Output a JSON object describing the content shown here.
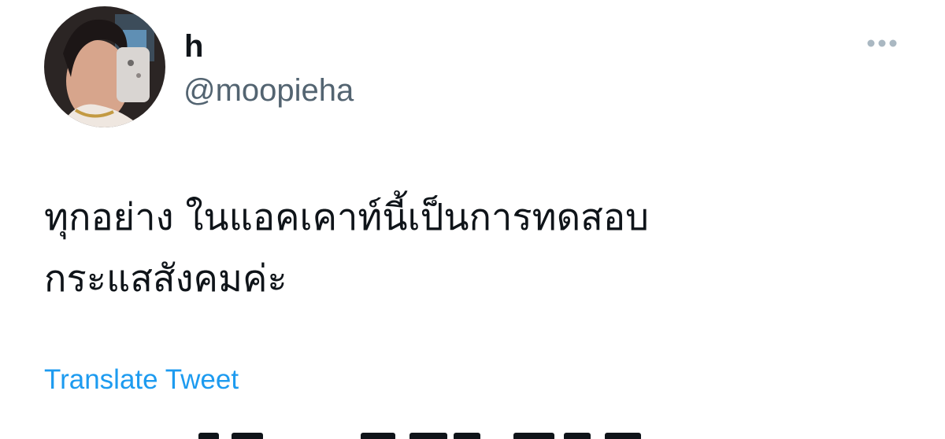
{
  "user": {
    "display_name": "h",
    "handle": "@moopieha"
  },
  "tweet": {
    "text_lines": [
      "ทุกอย่าง ในแอคเคาท์นี้เป็นการทดสอบ",
      "กระแสสังคมค่ะ"
    ],
    "translate_label": "Translate Tweet"
  },
  "icons": {
    "more": "more-horizontal-icon",
    "avatar": "profile-photo"
  },
  "colors": {
    "text_primary": "#0f1419",
    "text_secondary": "#536471",
    "link": "#1d9bf0",
    "more_dots": "#aab8c2"
  }
}
